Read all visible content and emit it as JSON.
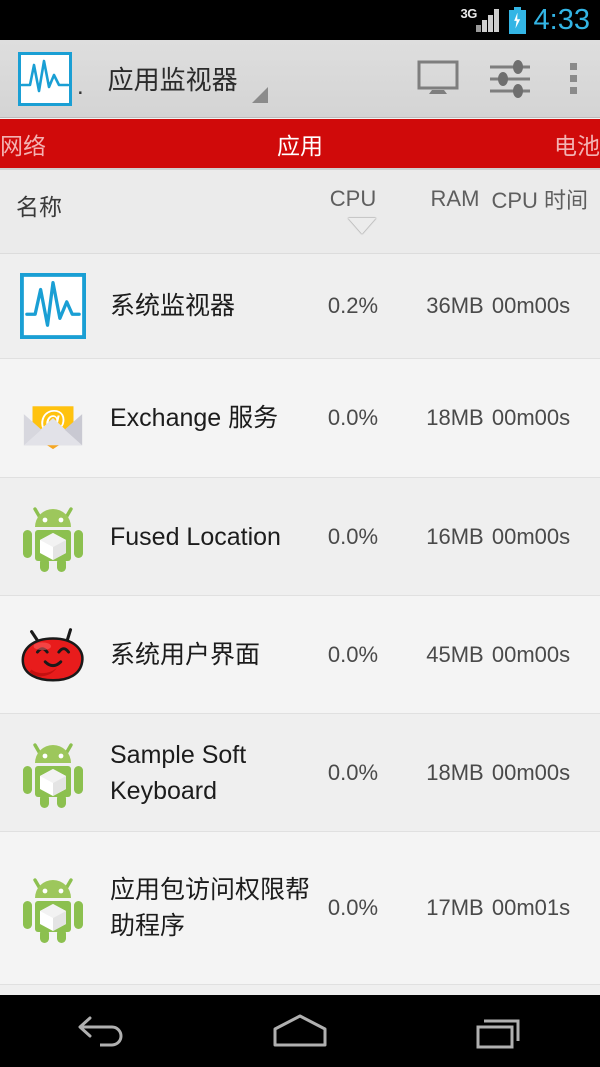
{
  "statusbar": {
    "network_type": "3G",
    "signal_icon": "signal-bars-icon",
    "battery_icon": "battery-charging-icon",
    "time": "4:33",
    "accent_color": "#33b5e5"
  },
  "actionbar": {
    "app_icon": "waveform-monitor-icon",
    "icon_suffix": ".",
    "title": "应用监视器",
    "spinner_icon": "dropdown-triangle-icon",
    "buttons": [
      {
        "name": "display-icon",
        "label": "显示"
      },
      {
        "name": "settings-sliders-icon",
        "label": "设置"
      },
      {
        "name": "overflow-menu-icon",
        "label": "更多选项"
      }
    ]
  },
  "tabs": {
    "accent_color": "#d00a0a",
    "items": [
      {
        "label": "网络",
        "active": false
      },
      {
        "label": "应用",
        "active": true
      },
      {
        "label": "电池",
        "active": false
      }
    ]
  },
  "columns": {
    "name": "名称",
    "cpu": "CPU",
    "ram": "RAM",
    "cpu_time": "CPU 时间",
    "sort_indicator": "sort-descending-arrow"
  },
  "rows": [
    {
      "icon": "waveform-monitor-icon",
      "name": "系统监视器",
      "cpu": "0.2%",
      "ram": "36MB",
      "time": "00m00s"
    },
    {
      "icon": "email-envelope-icon",
      "name": "Exchange 服务",
      "cpu": "0.0%",
      "ram": "18MB",
      "time": "00m00s"
    },
    {
      "icon": "android-robot-icon",
      "name": "Fused Location",
      "cpu": "0.0%",
      "ram": "16MB",
      "time": "00m00s"
    },
    {
      "icon": "jellybean-face-icon",
      "name": "系统用户界面",
      "cpu": "0.0%",
      "ram": "45MB",
      "time": "00m00s"
    },
    {
      "icon": "android-robot-icon",
      "name": "Sample Soft Keyboard",
      "cpu": "0.0%",
      "ram": "18MB",
      "time": "00m00s"
    },
    {
      "icon": "android-robot-icon",
      "name": "应用包访问权限帮助程序",
      "cpu": "0.0%",
      "ram": "17MB",
      "time": "00m01s"
    }
  ],
  "navbar": {
    "back": "back-icon",
    "home": "home-icon",
    "recents": "recents-icon"
  }
}
